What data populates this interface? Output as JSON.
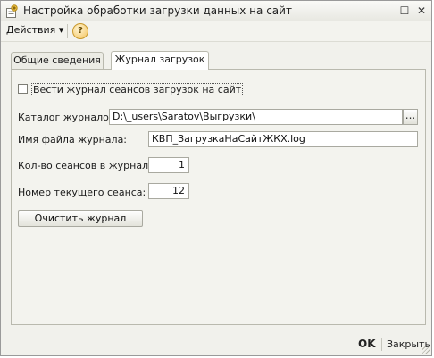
{
  "window": {
    "title": "Настройка обработки загрузки данных на сайт",
    "maximize_glyph": "☐",
    "close_glyph": "✕"
  },
  "toolbar": {
    "actions_label": "Действия ▾",
    "help_label": "?"
  },
  "tabs": [
    {
      "label": "Общие сведения",
      "active": false
    },
    {
      "label": "Журнал загрузок",
      "active": true
    }
  ],
  "form": {
    "log_checkbox_label": "Вести журнал сеансов загрузок на сайт",
    "log_checkbox_checked": false,
    "catalog_label": "Каталог журналов:",
    "catalog_value": "D:\\_users\\Saratov\\Выгрузки\\",
    "browse_label": "...",
    "filename_label": "Имя файла журнала:",
    "filename_value": "КВП_ЗагрузкаНаСайтЖКХ.log",
    "sessions_label": "Кол-во сеансов в журнале:",
    "sessions_value": "1",
    "current_session_label": "Номер текущего сеанса:",
    "current_session_value": "12",
    "clear_button_label": "Очистить журнал"
  },
  "footer": {
    "ok_label": "OK",
    "close_label": "Закрыть"
  },
  "colors": {
    "window_bg": "#f1f1ec",
    "panel_bg": "#f3f3ee",
    "border": "#b9b9ae",
    "help_icon": "#f3c25a"
  },
  "icons": {
    "title_icon": "form-settings-icon",
    "help_icon": "question-icon",
    "maximize_icon": "maximize-icon",
    "close_icon": "close-icon"
  }
}
